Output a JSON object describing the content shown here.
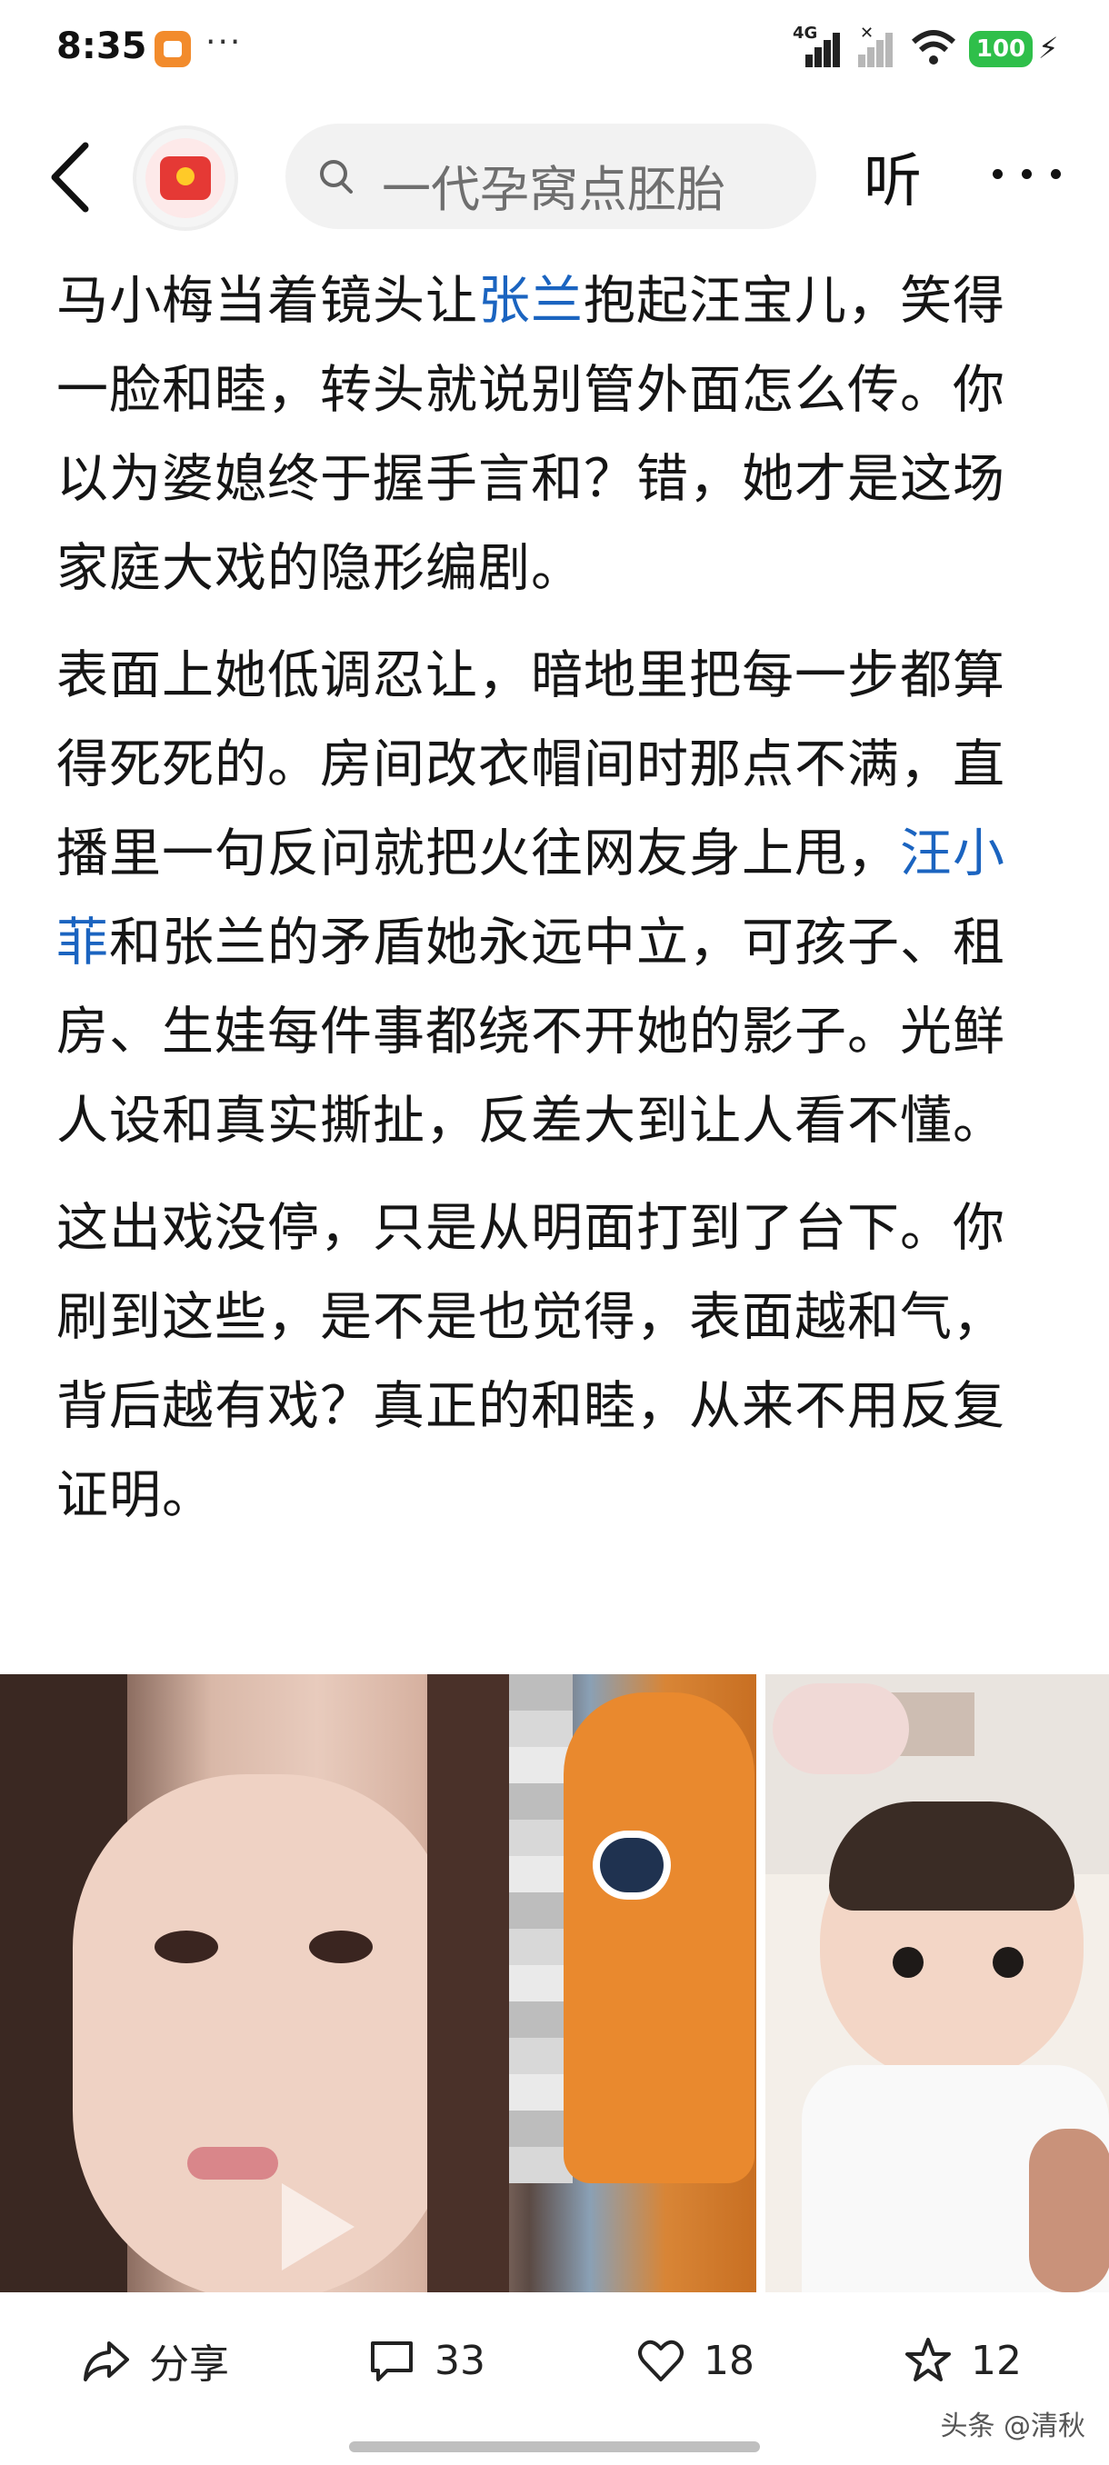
{
  "status_bar": {
    "time": "8:35",
    "more": "···",
    "network": "4G",
    "battery": "100",
    "icons": [
      "app-notification-icon",
      "signal-icon",
      "signal-muted-icon",
      "wifi-icon",
      "battery-icon",
      "charging-icon"
    ]
  },
  "nav": {
    "back_icon": "back-arrow-icon",
    "avatar_icon": "red-envelope-icon",
    "search_placeholder": "一代孕窝点胚胎",
    "listen_label": "听",
    "more_icon": "more-icon"
  },
  "article": {
    "paragraphs": [
      [
        "马小梅当着镜头让",
        "张兰",
        "抱起汪宝儿，笑得一脸和睦，转头就说别管外面怎么传。你以为婆媳终于握手言和？错，她才是这场家庭大戏的隐形编剧。"
      ],
      [
        "表面上她低调忍让，暗地里把每一步都算得死死的。房间改衣帽间时那点不满，直播里一句反问就把火往网友身上甩，",
        "汪小菲",
        "和张兰的矛盾她永远中立，可孩子、租房、生娃每件事都绕不开她的影子。光鲜人设和真实撕扯，反差大到让人看不懂。"
      ],
      [
        "这出戏没停，只是从明面打到了台下。你刷到这些，是不是也觉得，表面越和气，背后越有戏？真正的和睦，从来不用反复证明。"
      ]
    ]
  },
  "images": {
    "left_icon": "play-icon"
  },
  "actions": {
    "share": {
      "label": "分享",
      "icon": "share-icon"
    },
    "comment": {
      "count": "33",
      "icon": "comment-icon"
    },
    "like": {
      "count": "18",
      "icon": "heart-icon"
    },
    "favorite": {
      "count": "12",
      "icon": "star-icon"
    }
  },
  "watermark": "头条 @清秋",
  "colors": {
    "link": "#1b64c0",
    "battery": "#2fbf4a",
    "accent": "#e53935"
  }
}
